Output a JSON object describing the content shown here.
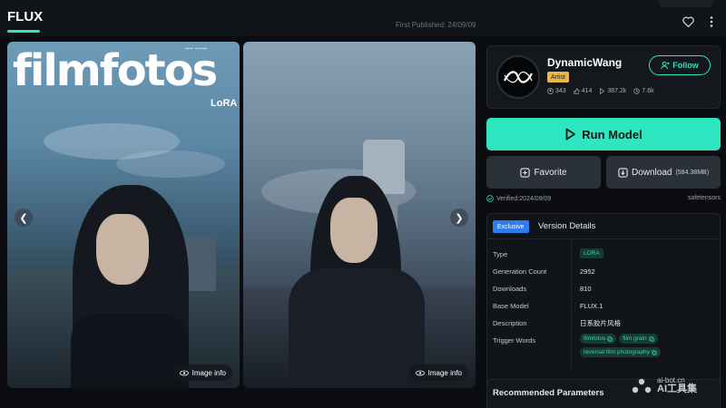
{
  "header": {
    "tab_label": "FLUX",
    "first_published": "First Published: 24/09/09"
  },
  "gallery": {
    "overlay_title": "filmfotos",
    "overlay_subtitle": "LoRA",
    "image_info_label": "Image info",
    "prev_icon": "chevron-left-icon",
    "next_icon": "chevron-right-icon"
  },
  "creator": {
    "name": "DynamicWang",
    "role": "Artist",
    "stats": {
      "followers": "343",
      "likes": "414",
      "downloads": "387.2k",
      "generations": "7.6k"
    },
    "follow_label": "Follow"
  },
  "actions": {
    "run_label": "Run Model",
    "favorite_label": "Favorite",
    "download_label": "Download",
    "download_size": "(584.38MB)"
  },
  "meta": {
    "verified": "Verified:2024/09/09",
    "file_type": "safetensors"
  },
  "version_details": {
    "badge": "Exclusive",
    "title": "Version Details",
    "rows": {
      "type_label": "Type",
      "type_value": "LORA",
      "generation_count_label": "Generation Count",
      "generation_count_value": "2952",
      "downloads_label": "Downloads",
      "downloads_value": "810",
      "base_model_label": "Base Model",
      "base_model_value": "FLUX.1",
      "description_label": "Description",
      "description_value": "日系胶片风格",
      "trigger_words_label": "Trigger Words"
    },
    "trigger_words": [
      "filmfotos",
      "film grain",
      "reversal film photography"
    ]
  },
  "recommended": {
    "title": "Recommended Parameters"
  },
  "watermark": {
    "url": "ai-bot.cn",
    "name": "AI工具集"
  },
  "colors": {
    "accent": "#2ee6c0",
    "badge_gold": "#e8b84a",
    "exclusive_blue": "#2f7bf0",
    "background": "#0b0d10"
  }
}
